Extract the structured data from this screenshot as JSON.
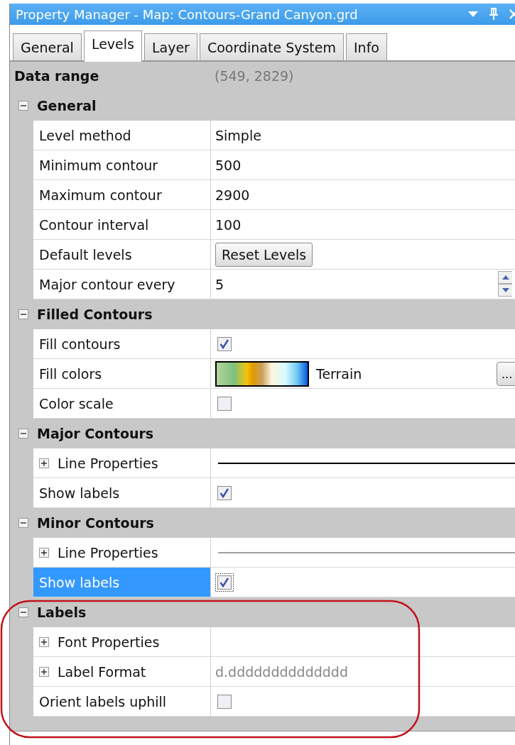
{
  "window": {
    "title": "Property Manager - Map: Contours-Grand Canyon.grd"
  },
  "tabs": [
    {
      "label": "General",
      "selected": false
    },
    {
      "label": "Levels",
      "selected": true
    },
    {
      "label": "Layer",
      "selected": false
    },
    {
      "label": "Coordinate System",
      "selected": false
    },
    {
      "label": "Info",
      "selected": false
    }
  ],
  "data_range": {
    "label": "Data range",
    "value": "(549, 2829)"
  },
  "sections": [
    {
      "title": "General",
      "expanded": true,
      "rows": [
        {
          "kind": "text",
          "label": "Level method",
          "value": "Simple",
          "expandable": false,
          "selected": false
        },
        {
          "kind": "text",
          "label": "Minimum contour",
          "value": "500",
          "expandable": false,
          "selected": false
        },
        {
          "kind": "text",
          "label": "Maximum contour",
          "value": "2900",
          "expandable": false,
          "selected": false
        },
        {
          "kind": "text",
          "label": "Contour interval",
          "value": "100",
          "expandable": false,
          "selected": false
        },
        {
          "kind": "button",
          "label": "Default levels",
          "value": "Reset Levels",
          "expandable": false,
          "selected": false
        },
        {
          "kind": "spin",
          "label": "Major contour every",
          "value": "5",
          "expandable": false,
          "selected": false
        }
      ]
    },
    {
      "title": "Filled Contours",
      "expanded": true,
      "rows": [
        {
          "kind": "check",
          "label": "Fill contours",
          "checked": true,
          "expandable": false,
          "selected": false
        },
        {
          "kind": "colormap",
          "label": "Fill colors",
          "value": "Terrain",
          "button_label": "...",
          "expandable": false,
          "selected": false
        },
        {
          "kind": "check",
          "label": "Color scale",
          "checked": false,
          "expandable": false,
          "selected": false
        }
      ]
    },
    {
      "title": "Major Contours",
      "expanded": true,
      "rows": [
        {
          "kind": "line",
          "label": "Line Properties",
          "heavy": true,
          "expandable": true,
          "selected": false
        },
        {
          "kind": "check",
          "label": "Show labels",
          "checked": true,
          "expandable": false,
          "selected": false
        }
      ]
    },
    {
      "title": "Minor Contours",
      "expanded": true,
      "rows": [
        {
          "kind": "line",
          "label": "Line Properties",
          "heavy": false,
          "expandable": true,
          "selected": false
        },
        {
          "kind": "check",
          "label": "Show labels",
          "checked": true,
          "expandable": false,
          "selected": true
        }
      ]
    },
    {
      "title": "Labels",
      "expanded": true,
      "rows": [
        {
          "kind": "text",
          "label": "Font Properties",
          "expandable": true,
          "selected": false
        },
        {
          "kind": "readonly",
          "label": "Label Format",
          "value": "d.dddddddddddddd",
          "expandable": true,
          "selected": false
        },
        {
          "kind": "check",
          "label": "Orient labels uphill",
          "checked": false,
          "expandable": false,
          "selected": false
        }
      ]
    }
  ]
}
